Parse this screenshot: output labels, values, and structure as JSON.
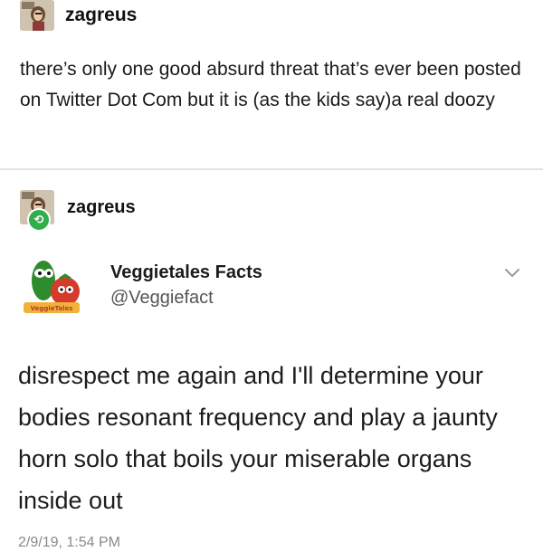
{
  "post1": {
    "username": "zagreus",
    "text": "there’s only one good absurd threat that’s ever been posted on Twitter Dot Com but it is (as the kids say)a real doozy"
  },
  "reblog": {
    "username": "zagreus"
  },
  "tweet": {
    "display_name": "Veggietales Facts",
    "handle": "@Veggiefact",
    "logo_text": "VeggieTales",
    "text": "disrespect me again and I'll determine your bodies resonant frequency and play a jaunty horn solo that boils your miserable organs inside out",
    "timestamp": "2/9/19, 1:54 PM"
  },
  "colors": {
    "reblog_green": "#2fae4a",
    "veggie_green": "#2e8b2e",
    "tomato_red": "#d63a2b",
    "handle_gray": "#555555",
    "divider": "#e3e3e3"
  }
}
